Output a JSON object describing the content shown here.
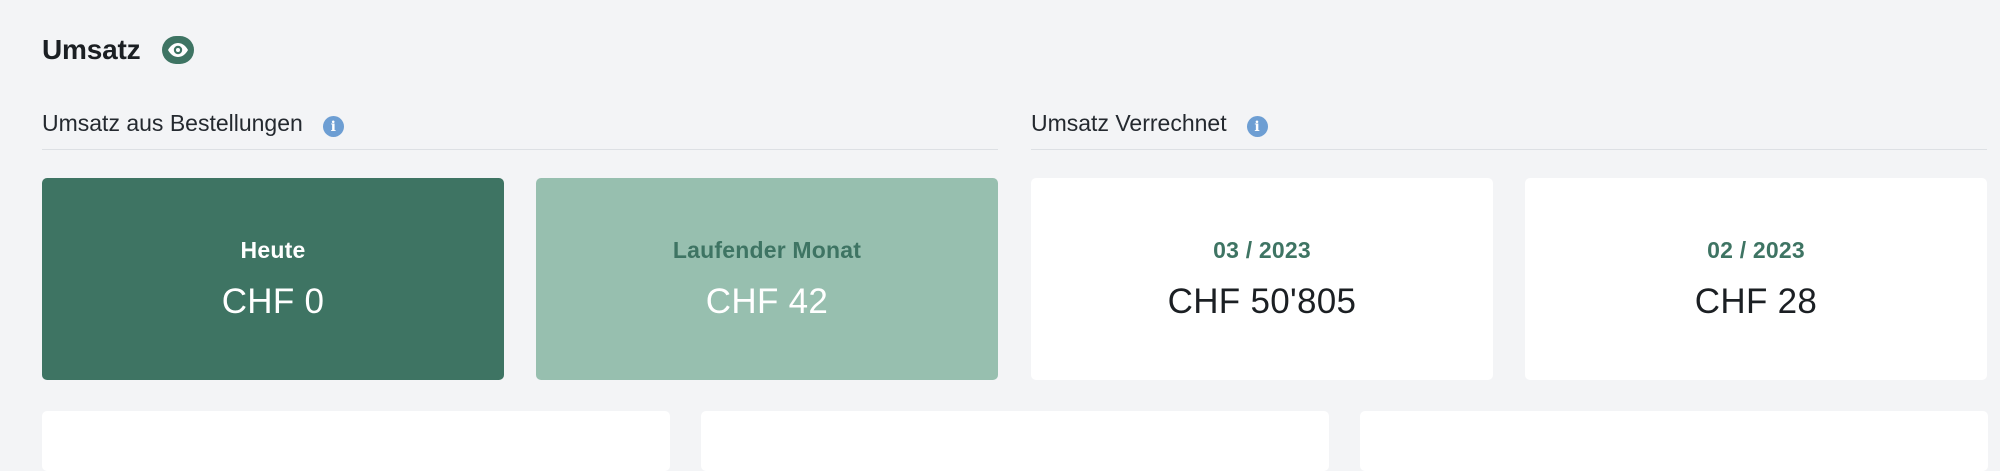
{
  "header": {
    "title": "Umsatz",
    "visibility_icon": "eye-icon"
  },
  "orders_section": {
    "title": "Umsatz aus Bestellungen",
    "info_icon": "i",
    "cards": [
      {
        "label": "Heute",
        "value": "CHF 0"
      },
      {
        "label": "Laufender Monat",
        "value": "CHF 42"
      }
    ]
  },
  "invoiced_section": {
    "title": "Umsatz Verrechnet",
    "info_icon": "i",
    "cards": [
      {
        "label": "03 / 2023",
        "value": "CHF 50'805"
      },
      {
        "label": "02 / 2023",
        "value": "CHF 28"
      }
    ]
  },
  "colors": {
    "primary_green": "#3e7463",
    "light_green": "#97bfaf",
    "info_blue": "#6d9ed3",
    "background": "#f3f4f6"
  }
}
